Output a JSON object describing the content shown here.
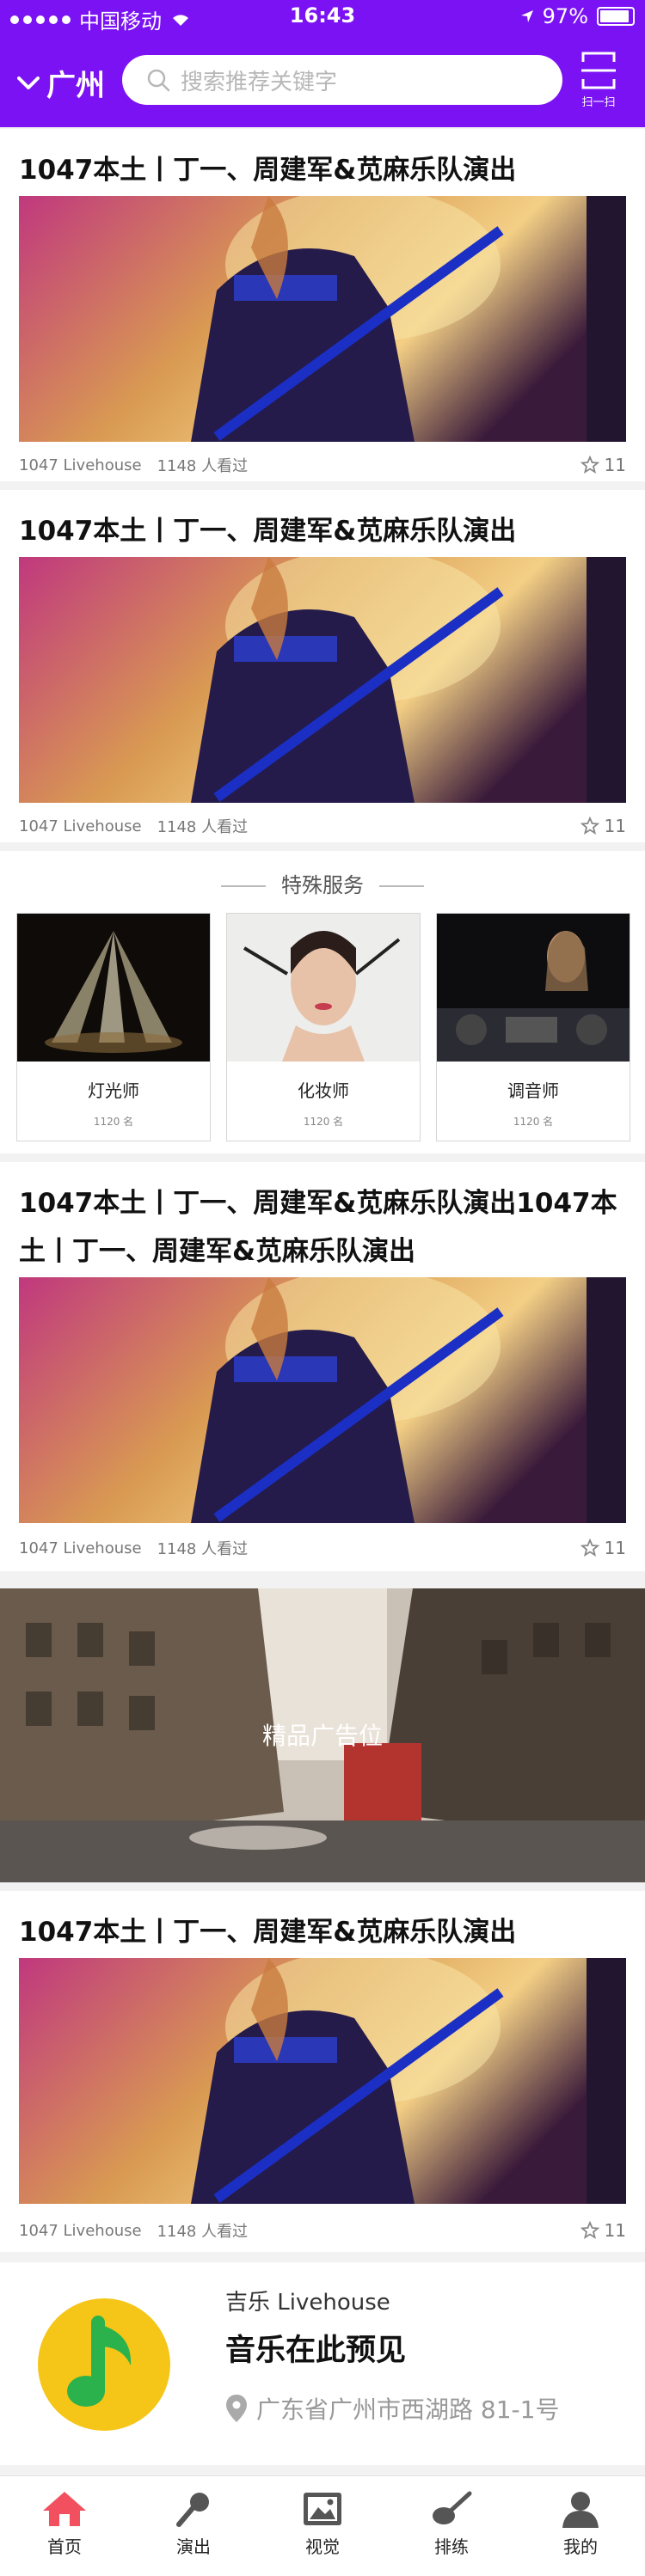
{
  "status": {
    "carrier": "中国移动",
    "time": "16:43",
    "battery": "97%"
  },
  "header": {
    "city": "广州",
    "search_placeholder": "搜索推荐关键字",
    "scan_label": "扫一扫"
  },
  "feed": [
    {
      "title": "1047本土丨丁一、周建军&苋麻乐队演出",
      "venue": "1047 Livehouse",
      "viewers": "1148 人看过",
      "favorites": "11"
    },
    {
      "title": "1047本土丨丁一、周建军&苋麻乐队演出",
      "venue": "1047 Livehouse",
      "viewers": "1148 人看过",
      "favorites": "11"
    },
    {
      "title": "1047本土丨丁一、周建军&苋麻乐队演出1047本土丨丁一、周建军&苋麻乐队演出",
      "venue": "1047 Livehouse",
      "viewers": "1148 人看过",
      "favorites": "11"
    },
    {
      "title": "1047本土丨丁一、周建军&苋麻乐队演出",
      "venue": "1047 Livehouse",
      "viewers": "1148 人看过",
      "favorites": "11"
    }
  ],
  "special_services": {
    "title": "特殊服务",
    "items": [
      {
        "name": "灯光师",
        "count": "1120 名"
      },
      {
        "name": "化妆师",
        "count": "1120 名"
      },
      {
        "name": "调音师",
        "count": "1120 名"
      }
    ]
  },
  "banner": {
    "text": "精品广告位"
  },
  "venue": {
    "name": "吉乐 Livehouse",
    "slogan": "音乐在此预见",
    "address": "广东省广州市西湖路 81-1号"
  },
  "tabs": [
    {
      "label": "首页",
      "icon": "home-icon",
      "active": true
    },
    {
      "label": "演出",
      "icon": "microphone-icon",
      "active": false
    },
    {
      "label": "视觉",
      "icon": "image-icon",
      "active": false
    },
    {
      "label": "排练",
      "icon": "guitar-icon",
      "active": false
    },
    {
      "label": "我的",
      "icon": "user-icon",
      "active": false
    }
  ],
  "colors": {
    "brand": "#7a12f4",
    "active_tab": "#f2505f"
  }
}
